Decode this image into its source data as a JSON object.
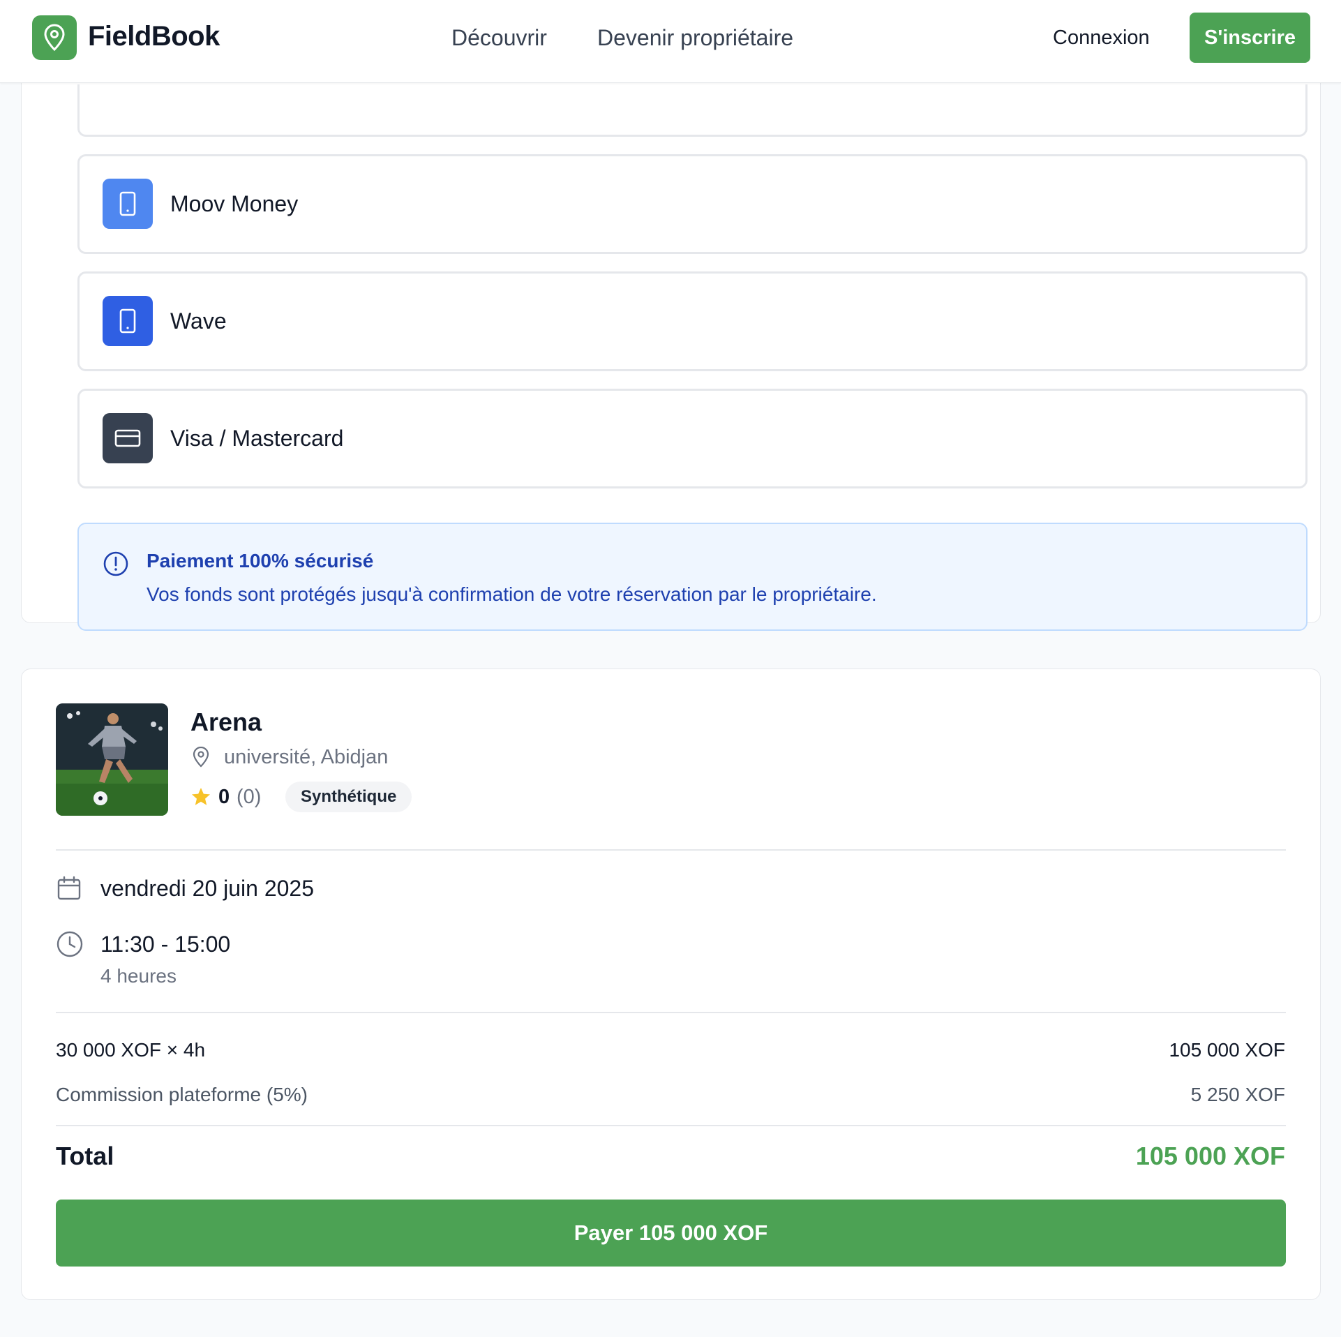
{
  "header": {
    "brand": "FieldBook",
    "nav": {
      "discover": "Découvrir",
      "become_owner": "Devenir propriétaire"
    },
    "login": "Connexion",
    "signup": "S'inscrire"
  },
  "payment_methods": [
    {
      "label": "Moov Money",
      "icon": "phone-icon",
      "color": "#4f87f0"
    },
    {
      "label": "Wave",
      "icon": "phone-icon",
      "color": "#2f5fe3"
    },
    {
      "label": "Visa / Mastercard",
      "icon": "credit-card-icon",
      "color": "#374151"
    }
  ],
  "secure_notice": {
    "title": "Paiement 100% sécurisé",
    "text": "Vos fonds sont protégés jusqu'à confirmation de votre réservation par le propriétaire."
  },
  "field": {
    "name": "Arena",
    "location": "université, Abidjan",
    "rating": "0",
    "rating_count": "(0)",
    "surface": "Synthétique"
  },
  "booking": {
    "date": "vendredi 20 juin 2025",
    "time": "11:30 - 15:00",
    "duration": "4 heures"
  },
  "pricing": {
    "rate_label": "30 000 XOF × 4h",
    "rate_value": "105 000 XOF",
    "commission_label": "Commission plateforme (5%)",
    "commission_value": "5 250 XOF",
    "total_label": "Total",
    "total_value": "105 000 XOF"
  },
  "pay_button": "Payer 105 000 XOF",
  "colors": {
    "brand_green": "#4ca254",
    "info_blue": "#1e40af"
  }
}
